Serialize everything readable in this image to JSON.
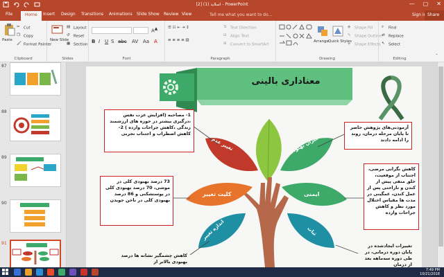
{
  "window": {
    "title": "اسلاید (1) [2] - PowerPoint",
    "controls": [
      "—",
      "▢",
      "✕"
    ]
  },
  "tabs": [
    {
      "label": "File"
    },
    {
      "label": "Home"
    },
    {
      "label": "Insert"
    },
    {
      "label": "Design"
    },
    {
      "label": "Transitions"
    },
    {
      "label": "Animations"
    },
    {
      "label": "Slide Show"
    },
    {
      "label": "Review"
    },
    {
      "label": "View"
    }
  ],
  "tell_me": "Tell me what you want to do...",
  "sign_in": "Sign in",
  "share": "Share",
  "ribbon": {
    "clipboard": {
      "paste": "Paste",
      "cut": "Cut",
      "copy": "Copy",
      "format_painter": "Format Painter",
      "label": "Clipboard"
    },
    "slides": {
      "new_slide": "New Slide",
      "layout": "Layout",
      "reset": "Reset",
      "section": "Section",
      "label": "Slides"
    },
    "font": {
      "label": "Font"
    },
    "paragraph": {
      "text_direction": "Text Direction",
      "align_text": "Align Text",
      "convert_smartart": "Convert to SmartArt",
      "label": "Paragraph"
    },
    "drawing": {
      "arrange": "Arrange",
      "quick_styles": "Quick Styles",
      "shape_fill": "Shape Fill",
      "shape_outline": "Shape Outline",
      "shape_effects": "Shape Effects",
      "label": "Drawing"
    },
    "editing": {
      "find": "Find",
      "replace": "Replace",
      "select": "Select",
      "label": "Editing"
    }
  },
  "thumbnails": [
    {
      "number": "87"
    },
    {
      "number": "88"
    },
    {
      "number": "89"
    },
    {
      "number": "90"
    },
    {
      "number": "91"
    }
  ],
  "slide": {
    "title": "معناداری بالینی",
    "leaves": {
      "left_upper": "تغییر عدم",
      "right_upper": "میزان بهبودی",
      "left_mid": "کلیت تغییر",
      "right_mid": "ایمنی",
      "left_low": "اندازه تغییر",
      "right_low": "ثبات"
    },
    "boxes": {
      "top_left": "1- مصاحبه (افزایش عزت نفس ،درگیری بیشتر در حوزه های ارزشمند زندگی ،کاهش جراحات وارده ) 2-کاهش اضطراب و اجتناب تجربی",
      "top_right": "آزمودنی‌های پژوهش حاضر تا پایان مرحله درمان، روند را ادامه دادند",
      "mid_left": "73 درصد بهبودی کلی در موشی، 70 درصد بهبودی کلی در پوستشکنی و 86 درصد بهبودی کلی در ناخن جویدن",
      "mid_right": "کاهش نگرانی مرضی، اجتناب از موقعیت، خلق منفی پیش از کندن و ناراحتی پس از عمل کندن، غمگینی در مدت ها مقیاس اختلال مورد نظر و کاهش جراحات وارده",
      "bottom_left": "کاهش چشمگیر نشانه ها درصد بهبودی بالاتر از",
      "bottom_right": "تغییرات ایجادشده در پایان دوره درمانی، در طی دوره سه‌ماهه بعد از درمان"
    }
  },
  "taskbar": {
    "time": "7:49 PM",
    "date": "10/21/2018"
  },
  "colors": {
    "accent": "#b7472a",
    "leaf_red": "#c0392b",
    "leaf_orange": "#e8732a",
    "leaf_green": "#3daa6a",
    "leaf_teal": "#1f8fa3",
    "leaf_lime": "#8dc63f",
    "hand": "#b5694a"
  }
}
